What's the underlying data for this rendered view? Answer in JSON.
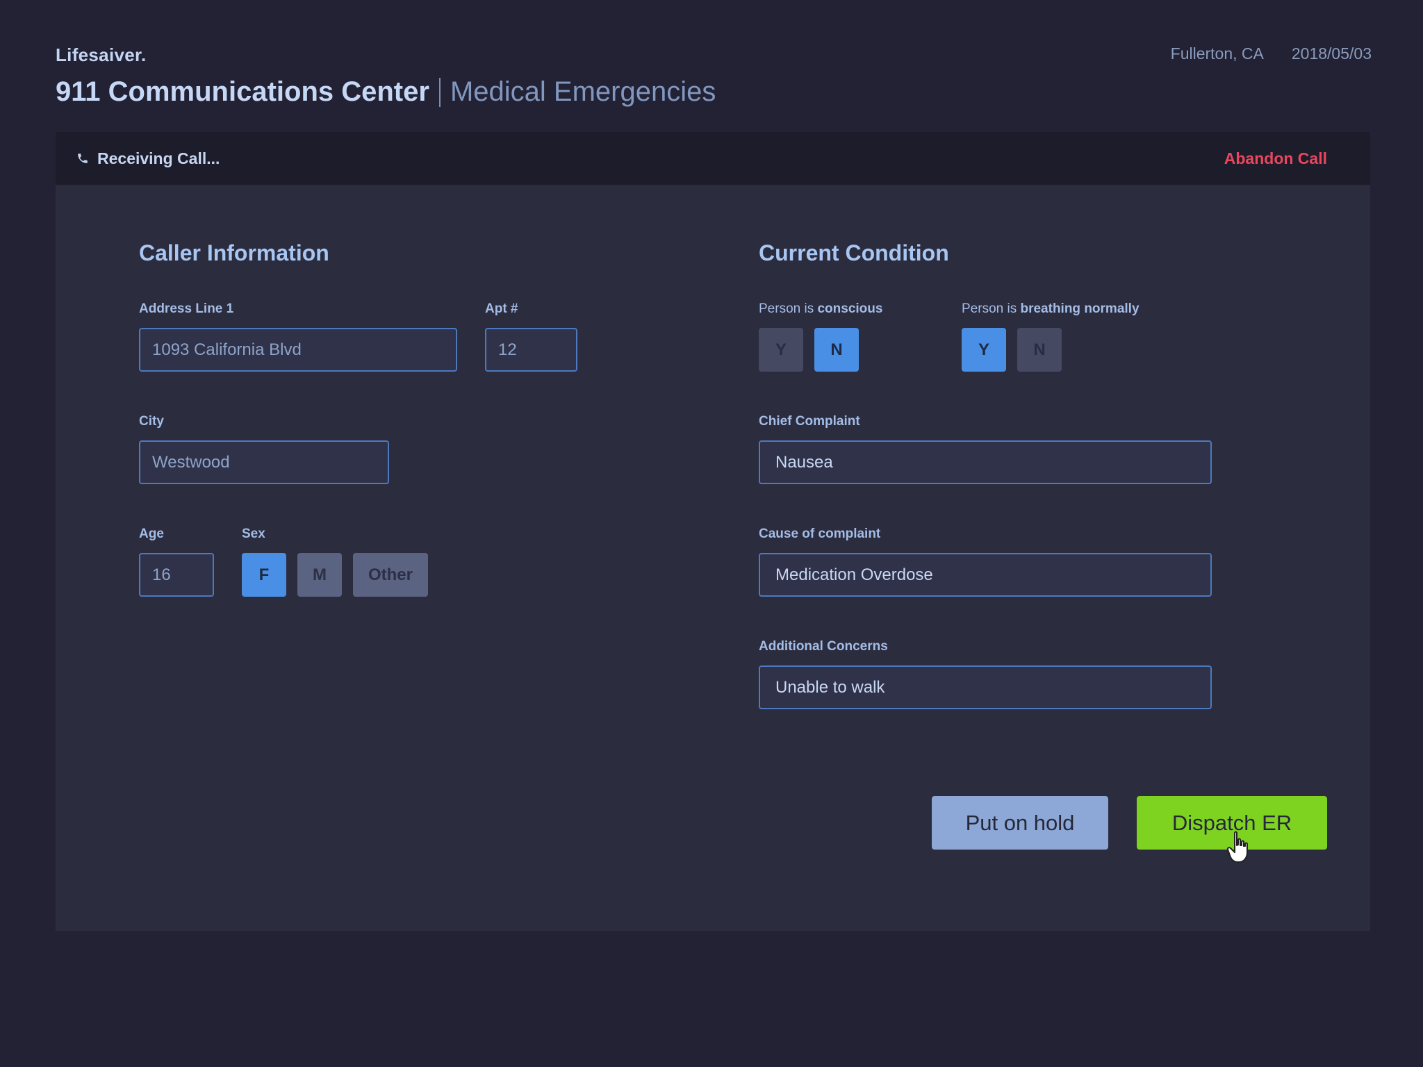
{
  "header": {
    "brand": "Lifesaiver.",
    "title": "911 Communications Center",
    "subtitle": "Medical Emergencies",
    "location": "Fullerton, CA",
    "date": "2018/05/03"
  },
  "call_bar": {
    "status": "Receiving Call...",
    "abandon_label": "Abandon Call",
    "icon": "phone-icon"
  },
  "caller": {
    "title": "Caller Information",
    "address_label": "Address Line 1",
    "address_value": "1093 California Blvd",
    "apt_label": "Apt #",
    "apt_value": "12",
    "city_label": "City",
    "city_value": "Westwood",
    "age_label": "Age",
    "age_value": "16",
    "sex_label": "Sex",
    "sex_options": [
      "F",
      "M",
      "Other"
    ],
    "sex_selected": "F"
  },
  "condition": {
    "title": "Current Condition",
    "conscious_label_prefix": "Person is ",
    "conscious_label_bold": "conscious",
    "conscious_options": [
      "Y",
      "N"
    ],
    "conscious_selected": "N",
    "breathing_label_prefix": "Person is ",
    "breathing_label_bold": "breathing normally",
    "breathing_options": [
      "Y",
      "N"
    ],
    "breathing_selected": "Y",
    "complaint_label": "Chief Complaint",
    "complaint_value": "Nausea",
    "cause_label": "Cause of complaint",
    "cause_value": "Medication Overdose",
    "concerns_label": "Additional Concerns",
    "concerns_value": "Unable to walk"
  },
  "actions": {
    "hold_label": "Put on hold",
    "dispatch_label": "Dispatch ER"
  },
  "colors": {
    "accent": "#4a8fe6",
    "danger": "#e8475e",
    "success": "#7ed321"
  }
}
